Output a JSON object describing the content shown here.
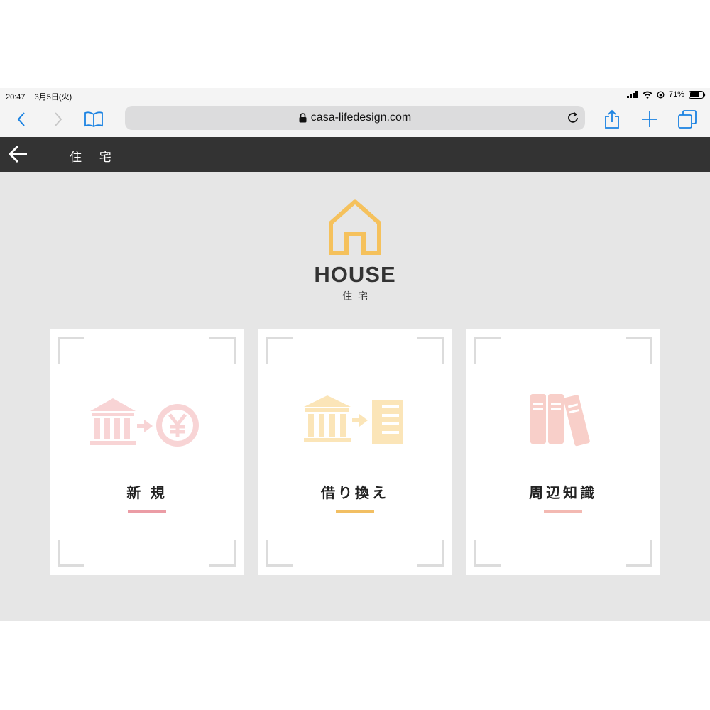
{
  "status_bar": {
    "time": "20:47",
    "date": "3月5日(火)",
    "battery": "71%",
    "icons": [
      "signal-icon",
      "wifi-icon",
      "rotation-lock-icon",
      "battery-icon"
    ]
  },
  "browser": {
    "url": "casa-lifedesign.com",
    "icons": [
      "back-icon",
      "forward-icon",
      "bookmarks-icon",
      "lock-icon",
      "reload-icon",
      "share-icon",
      "new-tab-icon",
      "tabs-icon"
    ],
    "accent": "#1a82e2"
  },
  "app_bar": {
    "title": "住 宅",
    "background": "#333333"
  },
  "logo": {
    "en": "HOUSE",
    "jp": "住宅",
    "color": "#f5c15c"
  },
  "cards": [
    {
      "label": "新 規",
      "icon": "bank-to-yen-icon",
      "accent": "#eb9ca5"
    },
    {
      "label": "借り換え",
      "icon": "bank-to-document-icon",
      "accent": "#f2bf63"
    },
    {
      "label": "周辺知識",
      "icon": "books-icon",
      "accent": "#f3b9b2"
    }
  ]
}
